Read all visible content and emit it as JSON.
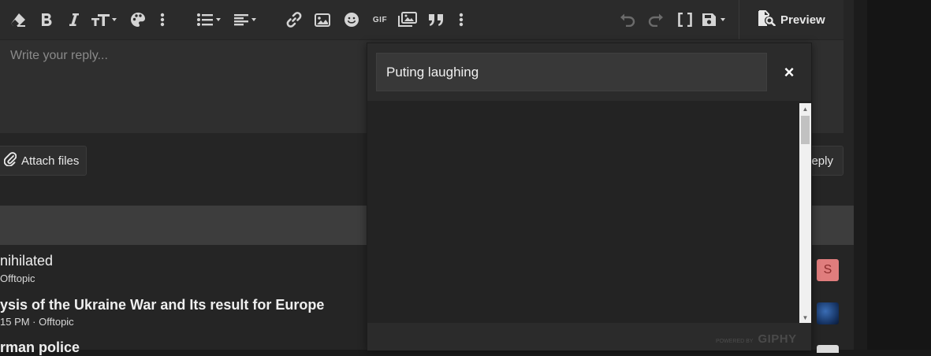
{
  "toolbar": {
    "icons": [
      "eraser-icon",
      "bold-icon",
      "italic-icon",
      "text-size-icon",
      "palette-icon",
      "more-vertical-icon",
      "list-icon",
      "align-icon",
      "link-icon",
      "image-icon",
      "smiley-icon",
      "gif-icon",
      "media-icon",
      "quote-icon",
      "more-vertical-icon",
      "undo-icon",
      "redo-icon",
      "brackets-icon",
      "save-icon"
    ],
    "gif_label": "GIF",
    "preview_label": "Preview"
  },
  "editor": {
    "placeholder": "Write your reply..."
  },
  "attach": {
    "label": "Attach files"
  },
  "reply": {
    "label": "eply"
  },
  "threads": [
    {
      "title": "nihilated",
      "meta": "Offtopic",
      "avatar_letter": "S"
    },
    {
      "title": "ysis of the Ukraine War and Its result for Europe",
      "meta": "15 PM · Offtopic"
    },
    {
      "title": "rman police"
    }
  ],
  "gif_popup": {
    "search_value": "Puting laughing",
    "close_label": "×",
    "powered_by": "POWERED BY",
    "brand": "GIPHY"
  },
  "colors": {
    "background": "#252525",
    "toolbar": "#2b2b2b",
    "popup": "#232323",
    "avatar_s": "#e07d7d"
  }
}
